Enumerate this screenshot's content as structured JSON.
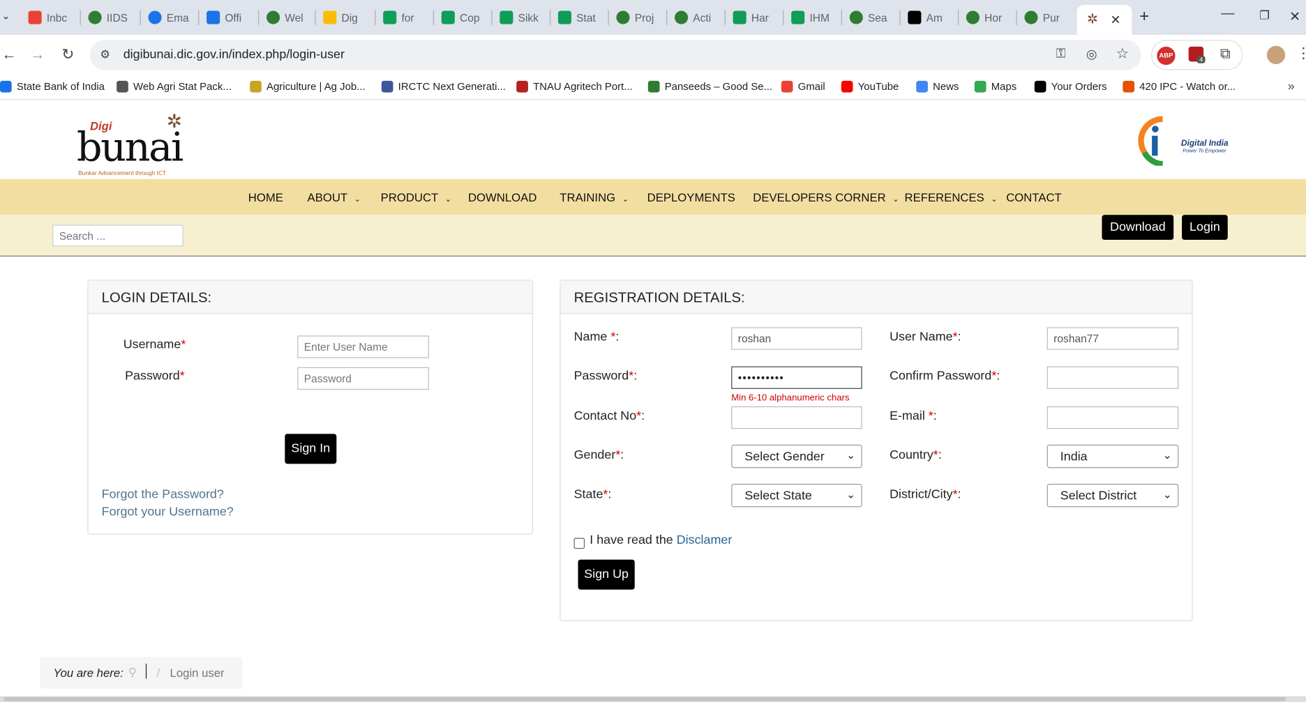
{
  "browser": {
    "tabs": [
      {
        "label": "Inbc",
        "icon": "gmail-icon"
      },
      {
        "label": "IIDS",
        "icon": "site-icon"
      },
      {
        "label": "Ema",
        "icon": "at-icon"
      },
      {
        "label": "Offi",
        "icon": "dpa-icon"
      },
      {
        "label": "Wel",
        "icon": "site-icon"
      },
      {
        "label": "Dig",
        "icon": "drive-icon"
      },
      {
        "label": "for",
        "icon": "sheets-icon"
      },
      {
        "label": "Cop",
        "icon": "sheets-icon"
      },
      {
        "label": "Sikk",
        "icon": "sheets-icon"
      },
      {
        "label": "Stat",
        "icon": "sheets-icon"
      },
      {
        "label": "Proj",
        "icon": "site-icon"
      },
      {
        "label": "Acti",
        "icon": "site-icon"
      },
      {
        "label": "Har",
        "icon": "sheets-icon"
      },
      {
        "label": "IHM",
        "icon": "sheets-icon"
      },
      {
        "label": "Sea",
        "icon": "site-icon"
      },
      {
        "label": "Am",
        "icon": "amazon-icon"
      },
      {
        "label": "Hor",
        "icon": "site-icon"
      },
      {
        "label": "Pur",
        "icon": "site-icon"
      }
    ],
    "url": "digibunai.dic.gov.in/index.php/login-user",
    "extension_badge": "4",
    "abp_label": "ABP",
    "bookmarks": [
      {
        "label": "State Bank of India",
        "color": "#1a73e8"
      },
      {
        "label": "Web Agri Stat Pack...",
        "color": "#555555"
      },
      {
        "label": "Agriculture | Ag Job...",
        "color": "#c9a227"
      },
      {
        "label": "IRCTC Next Generati...",
        "color": "#3b5998"
      },
      {
        "label": "TNAU Agritech Port...",
        "color": "#b22222"
      },
      {
        "label": "Panseeds – Good Se...",
        "color": "#2e7d32"
      },
      {
        "label": "Gmail",
        "color": "#ea4335"
      },
      {
        "label": "YouTube",
        "color": "#ff0000"
      },
      {
        "label": "News",
        "color": "#4285f4"
      },
      {
        "label": "Maps",
        "color": "#34a853"
      },
      {
        "label": "Your Orders",
        "color": "#000000"
      },
      {
        "label": "420 IPC - Watch or...",
        "color": "#e65100"
      }
    ]
  },
  "site": {
    "logo": {
      "digi": "Digi",
      "bunai": "bunai",
      "tagline": "Bunkar Advancement through ICT"
    },
    "digital_india": {
      "title": "Digital India",
      "subtitle": "Power To Empower"
    },
    "nav": [
      {
        "label": "HOME",
        "dropdown": false
      },
      {
        "label": "ABOUT",
        "dropdown": true
      },
      {
        "label": "PRODUCT",
        "dropdown": true
      },
      {
        "label": "DOWNLOAD",
        "dropdown": false
      },
      {
        "label": "TRAINING",
        "dropdown": true
      },
      {
        "label": "DEPLOYMENTS",
        "dropdown": false
      },
      {
        "label": "DEVELOPERS CORNER",
        "dropdown": true
      },
      {
        "label": "REFERENCES",
        "dropdown": true
      },
      {
        "label": "CONTACT",
        "dropdown": false
      }
    ],
    "search_placeholder": "Search ...",
    "download_button": "Download",
    "login_button": "Login"
  },
  "login": {
    "heading": "LOGIN DETAILS:",
    "username_label": "Username",
    "username_placeholder": "Enter User Name",
    "password_label": "Password",
    "password_placeholder": "Password",
    "signin_button": "Sign In",
    "forgot_password": "Forgot the Password?",
    "forgot_username": "Forgot your Username?"
  },
  "registration": {
    "heading": "REGISTRATION DETAILS:",
    "name_label": "Name ",
    "name_value": "roshan",
    "username_label": "User Name",
    "username_value": "roshan77",
    "password_label": "Password",
    "password_value": "••••••••••",
    "password_hint": "Min 6-10 alphanumeric chars",
    "confirm_label": "Confirm Password",
    "contact_label": "Contact No",
    "email_label": "E-mail ",
    "gender_label": "Gender",
    "gender_value": "Select Gender",
    "country_label": "Country",
    "country_value": "India",
    "state_label": "State",
    "state_value": "Select State",
    "district_label": "District/City",
    "district_value": "Select District",
    "disclaimer_text": "I have read the ",
    "disclaimer_link": "Disclamer",
    "signup_button": "Sign Up",
    "required_mark": "*",
    "colon": ":"
  },
  "breadcrumb": {
    "prefix": "You are here:",
    "separator": "/",
    "current": "Login user"
  },
  "colors": {
    "nav_bg": "#f3dea1",
    "subbar_bg": "#f7f0d0",
    "link": "#4d7591",
    "required": "#cc0000"
  }
}
